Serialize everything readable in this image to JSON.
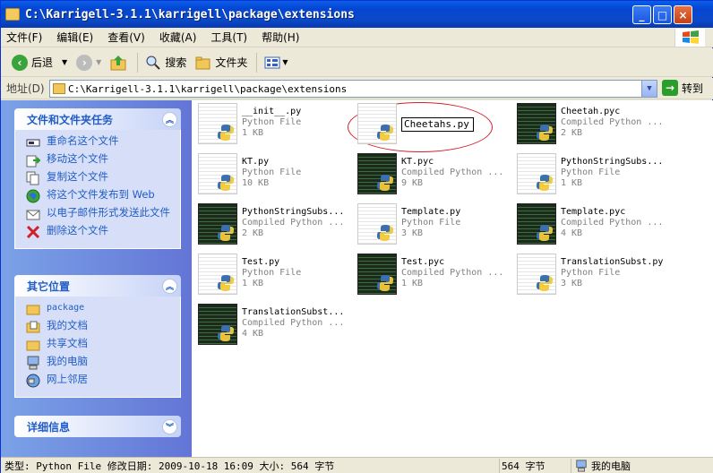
{
  "window": {
    "title": "C:\\Karrigell-3.1.1\\karrigell\\package\\extensions",
    "controls": [
      "_",
      "□",
      "×"
    ]
  },
  "menu": [
    "文件(F)",
    "编辑(E)",
    "查看(V)",
    "收藏(A)",
    "工具(T)",
    "帮助(H)"
  ],
  "toolbar": {
    "back": "后退",
    "search": "搜索",
    "folders": "文件夹"
  },
  "address": {
    "label": "地址(D)",
    "path": "C:\\Karrigell-3.1.1\\karrigell\\package\\extensions",
    "go": "转到"
  },
  "tasks": {
    "title": "文件和文件夹任务",
    "items": [
      "重命名这个文件",
      "移动这个文件",
      "复制这个文件",
      "将这个文件发布到 Web",
      "以电子邮件形式发送此文件",
      "删除这个文件"
    ]
  },
  "places": {
    "title": "其它位置",
    "items": [
      "package",
      "我的文档",
      "共享文档",
      "我的电脑",
      "网上邻居"
    ]
  },
  "details": {
    "title": "详细信息"
  },
  "files": [
    {
      "name": "__init__.py",
      "type": "Python File",
      "size": "1 KB",
      "kind": "py"
    },
    {
      "name": "Cheetahs.py",
      "type": "",
      "size": "",
      "kind": "py",
      "renaming": true
    },
    {
      "name": "Cheetah.pyc",
      "type": "Compiled Python ...",
      "size": "2 KB",
      "kind": "pyc"
    },
    {
      "name": "KT.py",
      "type": "Python File",
      "size": "10 KB",
      "kind": "py"
    },
    {
      "name": "KT.pyc",
      "type": "Compiled Python ...",
      "size": "9 KB",
      "kind": "pyc"
    },
    {
      "name": "PythonStringSubs...",
      "type": "Python File",
      "size": "1 KB",
      "kind": "py"
    },
    {
      "name": "PythonStringSubs...",
      "type": "Compiled Python ...",
      "size": "2 KB",
      "kind": "pyc"
    },
    {
      "name": "Template.py",
      "type": "Python File",
      "size": "3 KB",
      "kind": "py"
    },
    {
      "name": "Template.pyc",
      "type": "Compiled Python ...",
      "size": "4 KB",
      "kind": "pyc"
    },
    {
      "name": "Test.py",
      "type": "Python File",
      "size": "1 KB",
      "kind": "py"
    },
    {
      "name": "Test.pyc",
      "type": "Compiled Python ...",
      "size": "1 KB",
      "kind": "pyc"
    },
    {
      "name": "TranslationSubst.py",
      "type": "Python File",
      "size": "3 KB",
      "kind": "py"
    },
    {
      "name": "TranslationSubst...",
      "type": "Compiled Python ...",
      "size": "4 KB",
      "kind": "pyc"
    }
  ],
  "status": {
    "info": "类型: Python File 修改日期: 2009-10-18 16:09 大小: 564 字节",
    "size": "564 字节",
    "location": "我的电脑"
  },
  "colors": {
    "titlebar": "#0545d4",
    "taskpane": "#6375d6",
    "link": "#215dc6",
    "highlight_oval": "#d0202a"
  }
}
